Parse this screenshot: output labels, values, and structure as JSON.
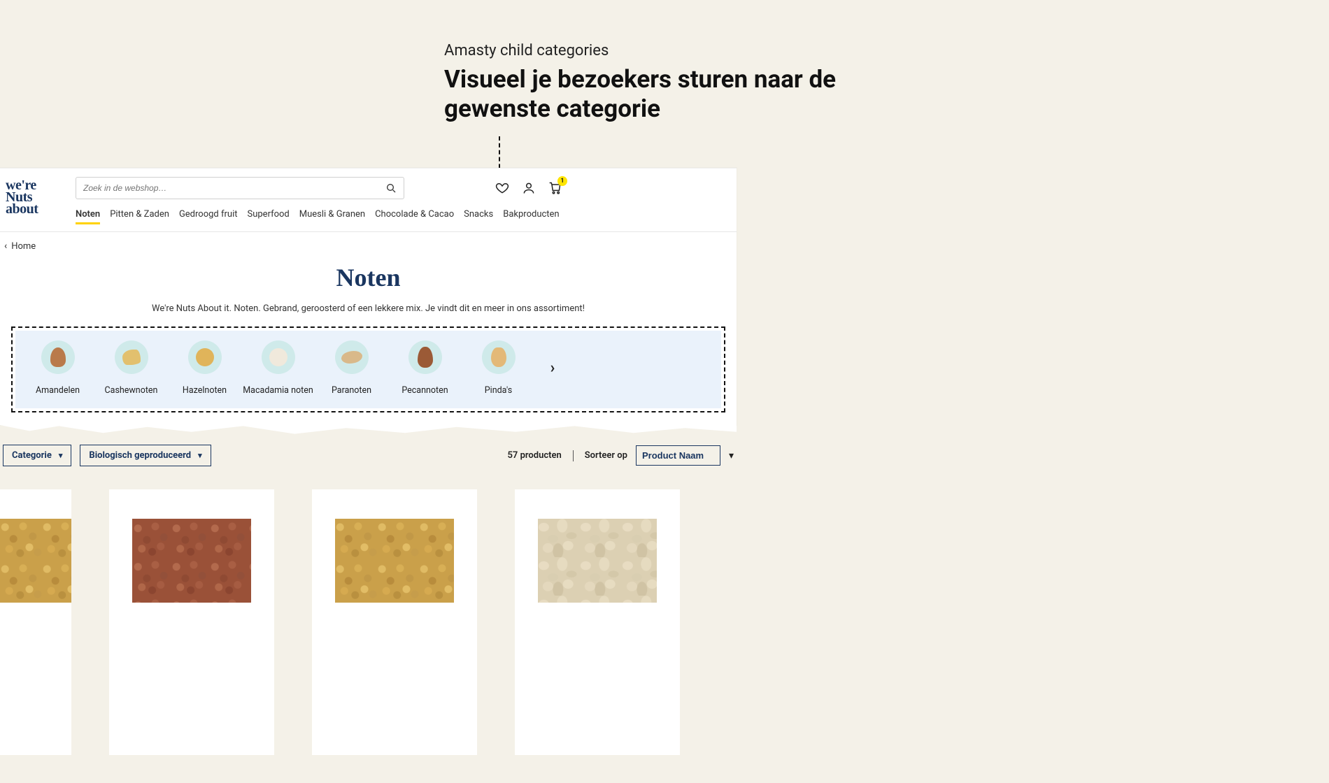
{
  "heading": {
    "eyebrow": "Amasty child categories",
    "headline": "Visueel je bezoekers sturen naar de gewenste categorie"
  },
  "logo": {
    "line1": "we're",
    "line2": "Nuts",
    "line3": "about"
  },
  "search": {
    "placeholder": "Zoek in de webshop…"
  },
  "cart": {
    "count": "1"
  },
  "nav": {
    "items": [
      {
        "label": "Noten",
        "active": true
      },
      {
        "label": "Pitten & Zaden"
      },
      {
        "label": "Gedroogd fruit"
      },
      {
        "label": "Superfood"
      },
      {
        "label": "Muesli & Granen"
      },
      {
        "label": "Chocolade & Cacao"
      },
      {
        "label": "Snacks"
      },
      {
        "label": "Bakproducten"
      }
    ]
  },
  "breadcrumb": {
    "back": "Home"
  },
  "page": {
    "title": "Noten",
    "subtitle": "We're Nuts About it. Noten. Gebrand, geroosterd of een lekkere mix. Je vindt dit en meer in ons assortiment!"
  },
  "cats": {
    "items": [
      {
        "label": "Amandelen"
      },
      {
        "label": "Cashewnoten"
      },
      {
        "label": "Hazelnoten"
      },
      {
        "label": "Macadamia noten"
      },
      {
        "label": "Paranoten"
      },
      {
        "label": "Pecannoten"
      },
      {
        "label": "Pinda's"
      }
    ]
  },
  "filters": {
    "category_label": "Categorie",
    "organic_label": "Biologisch geproduceerd",
    "count": "57 producten",
    "sort_label": "Sorteer op",
    "sort_value": "Product Naam"
  }
}
